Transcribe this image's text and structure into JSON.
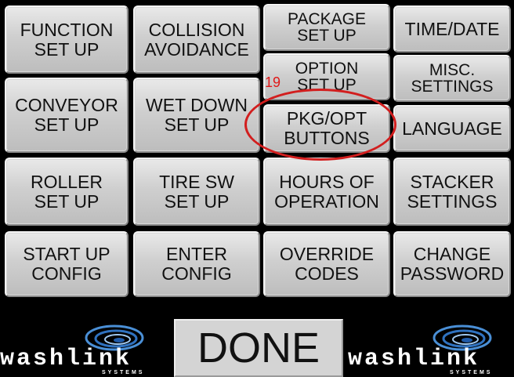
{
  "menu": {
    "function_setup": [
      "FUNCTION",
      "SET UP"
    ],
    "collision_avoidance": [
      "COLLISION",
      "AVOIDANCE"
    ],
    "package_setup": [
      "PACKAGE",
      "SET UP"
    ],
    "time_date": [
      "TIME/DATE"
    ],
    "option_setup": [
      "OPTION",
      "SET UP"
    ],
    "misc_settings": [
      "MISC.",
      "SETTINGS"
    ],
    "conveyor_setup": [
      "CONVEYOR",
      "SET UP"
    ],
    "wet_down_setup": [
      "WET DOWN",
      "SET UP"
    ],
    "pkg_opt_buttons": [
      "PKG/OPT",
      "BUTTONS"
    ],
    "language": [
      "LANGUAGE"
    ],
    "roller_setup": [
      "ROLLER",
      "SET UP"
    ],
    "tire_sw_setup": [
      "TIRE SW",
      "SET UP"
    ],
    "hours_of_operation": [
      "HOURS OF",
      "OPERATION"
    ],
    "stacker_settings": [
      "STACKER",
      "SETTINGS"
    ],
    "start_up_config": [
      "START UP",
      "CONFIG"
    ],
    "enter_config": [
      "ENTER",
      "CONFIG"
    ],
    "override_codes": [
      "OVERRIDE",
      "CODES"
    ],
    "change_password": [
      "CHANGE",
      "PASSWORD"
    ]
  },
  "footer": {
    "done_label": "DONE",
    "logo_word": "washlink",
    "logo_sub": "SYSTEMS"
  },
  "annotation": {
    "number": "19",
    "color": "#d21e1e"
  }
}
